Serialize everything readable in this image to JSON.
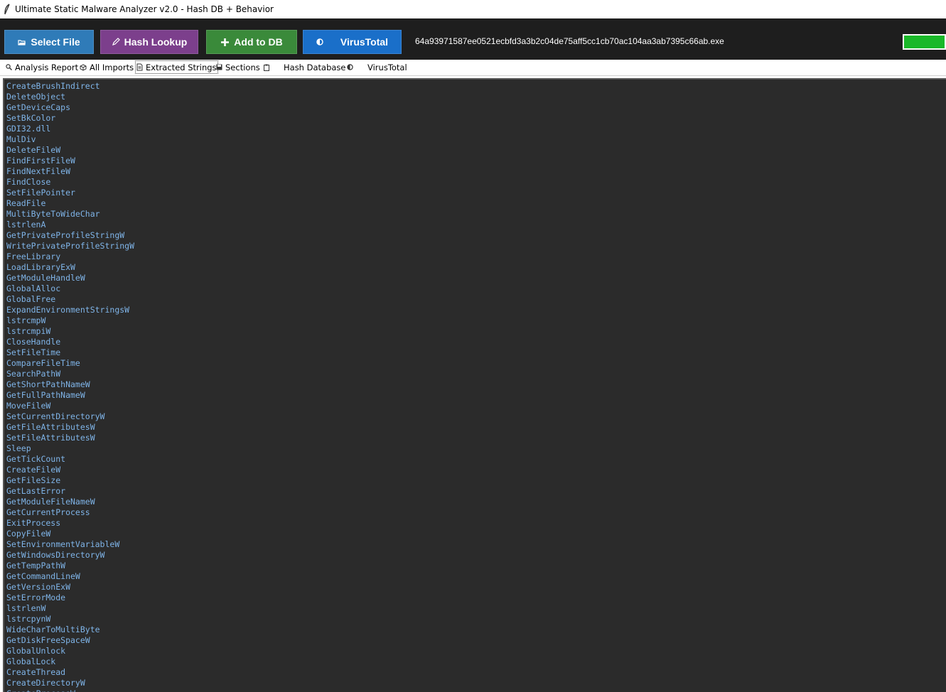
{
  "window": {
    "title": "Ultimate Static Malware Analyzer v2.0 - Hash DB + Behavior",
    "icon": "feather-icon"
  },
  "toolbar": {
    "select_file_label": "Select File",
    "hash_lookup_label": "Hash Lookup",
    "add_db_label": "Add to DB",
    "virustotal_label": "VirusTotal",
    "file_name": "64a93971587ee0521ecbfd3a3b2c04de75aff5cc1cb70ac104aa3ab7395c66ab.exe",
    "progress_fraction": 1.0,
    "colors": {
      "select_file": "#2f7bb8",
      "hash_lookup": "#7c3f8c",
      "add_db": "#3a8a3a",
      "virustotal": "#1a6fc9",
      "progress": "#1ab829"
    }
  },
  "tabs": [
    {
      "label": "Analysis Report",
      "icon": "magnifier-icon",
      "selected": false
    },
    {
      "label": "All Imports",
      "icon": "package-icon",
      "selected": false
    },
    {
      "label": "Extracted Strings",
      "icon": "document-icon",
      "selected": true
    },
    {
      "label": "Sections",
      "icon": "floppy-icon",
      "selected": false
    },
    {
      "label": "Hash Database",
      "icon": "clipboard-icon",
      "selected": false
    },
    {
      "label": "VirusTotal",
      "icon": "shield-icon",
      "selected": false
    }
  ],
  "strings": [
    "CreateBrushIndirect",
    "DeleteObject",
    "GetDeviceCaps",
    "SetBkColor",
    "GDI32.dll",
    "MulDiv",
    "DeleteFileW",
    "FindFirstFileW",
    "FindNextFileW",
    "FindClose",
    "SetFilePointer",
    "ReadFile",
    "MultiByteToWideChar",
    "lstrlenA",
    "GetPrivateProfileStringW",
    "WritePrivateProfileStringW",
    "FreeLibrary",
    "LoadLibraryExW",
    "GetModuleHandleW",
    "GlobalAlloc",
    "GlobalFree",
    "ExpandEnvironmentStringsW",
    "lstrcmpW",
    "lstrcmpiW",
    "CloseHandle",
    "SetFileTime",
    "CompareFileTime",
    "SearchPathW",
    "GetShortPathNameW",
    "GetFullPathNameW",
    "MoveFileW",
    "SetCurrentDirectoryW",
    "GetFileAttributesW",
    "SetFileAttributesW",
    "Sleep",
    "GetTickCount",
    "CreateFileW",
    "GetFileSize",
    "GetLastError",
    "GetModuleFileNameW",
    "GetCurrentProcess",
    "ExitProcess",
    "CopyFileW",
    "SetEnvironmentVariableW",
    "GetWindowsDirectoryW",
    "GetTempPathW",
    "GetCommandLineW",
    "GetVersionExW",
    "SetErrorMode",
    "lstrlenW",
    "lstrcpynW",
    "WideCharToMultiByte",
    "GetDiskFreeSpaceW",
    "GlobalUnlock",
    "GlobalLock",
    "CreateThread",
    "CreateDirectoryW",
    "CreateProcessW"
  ]
}
